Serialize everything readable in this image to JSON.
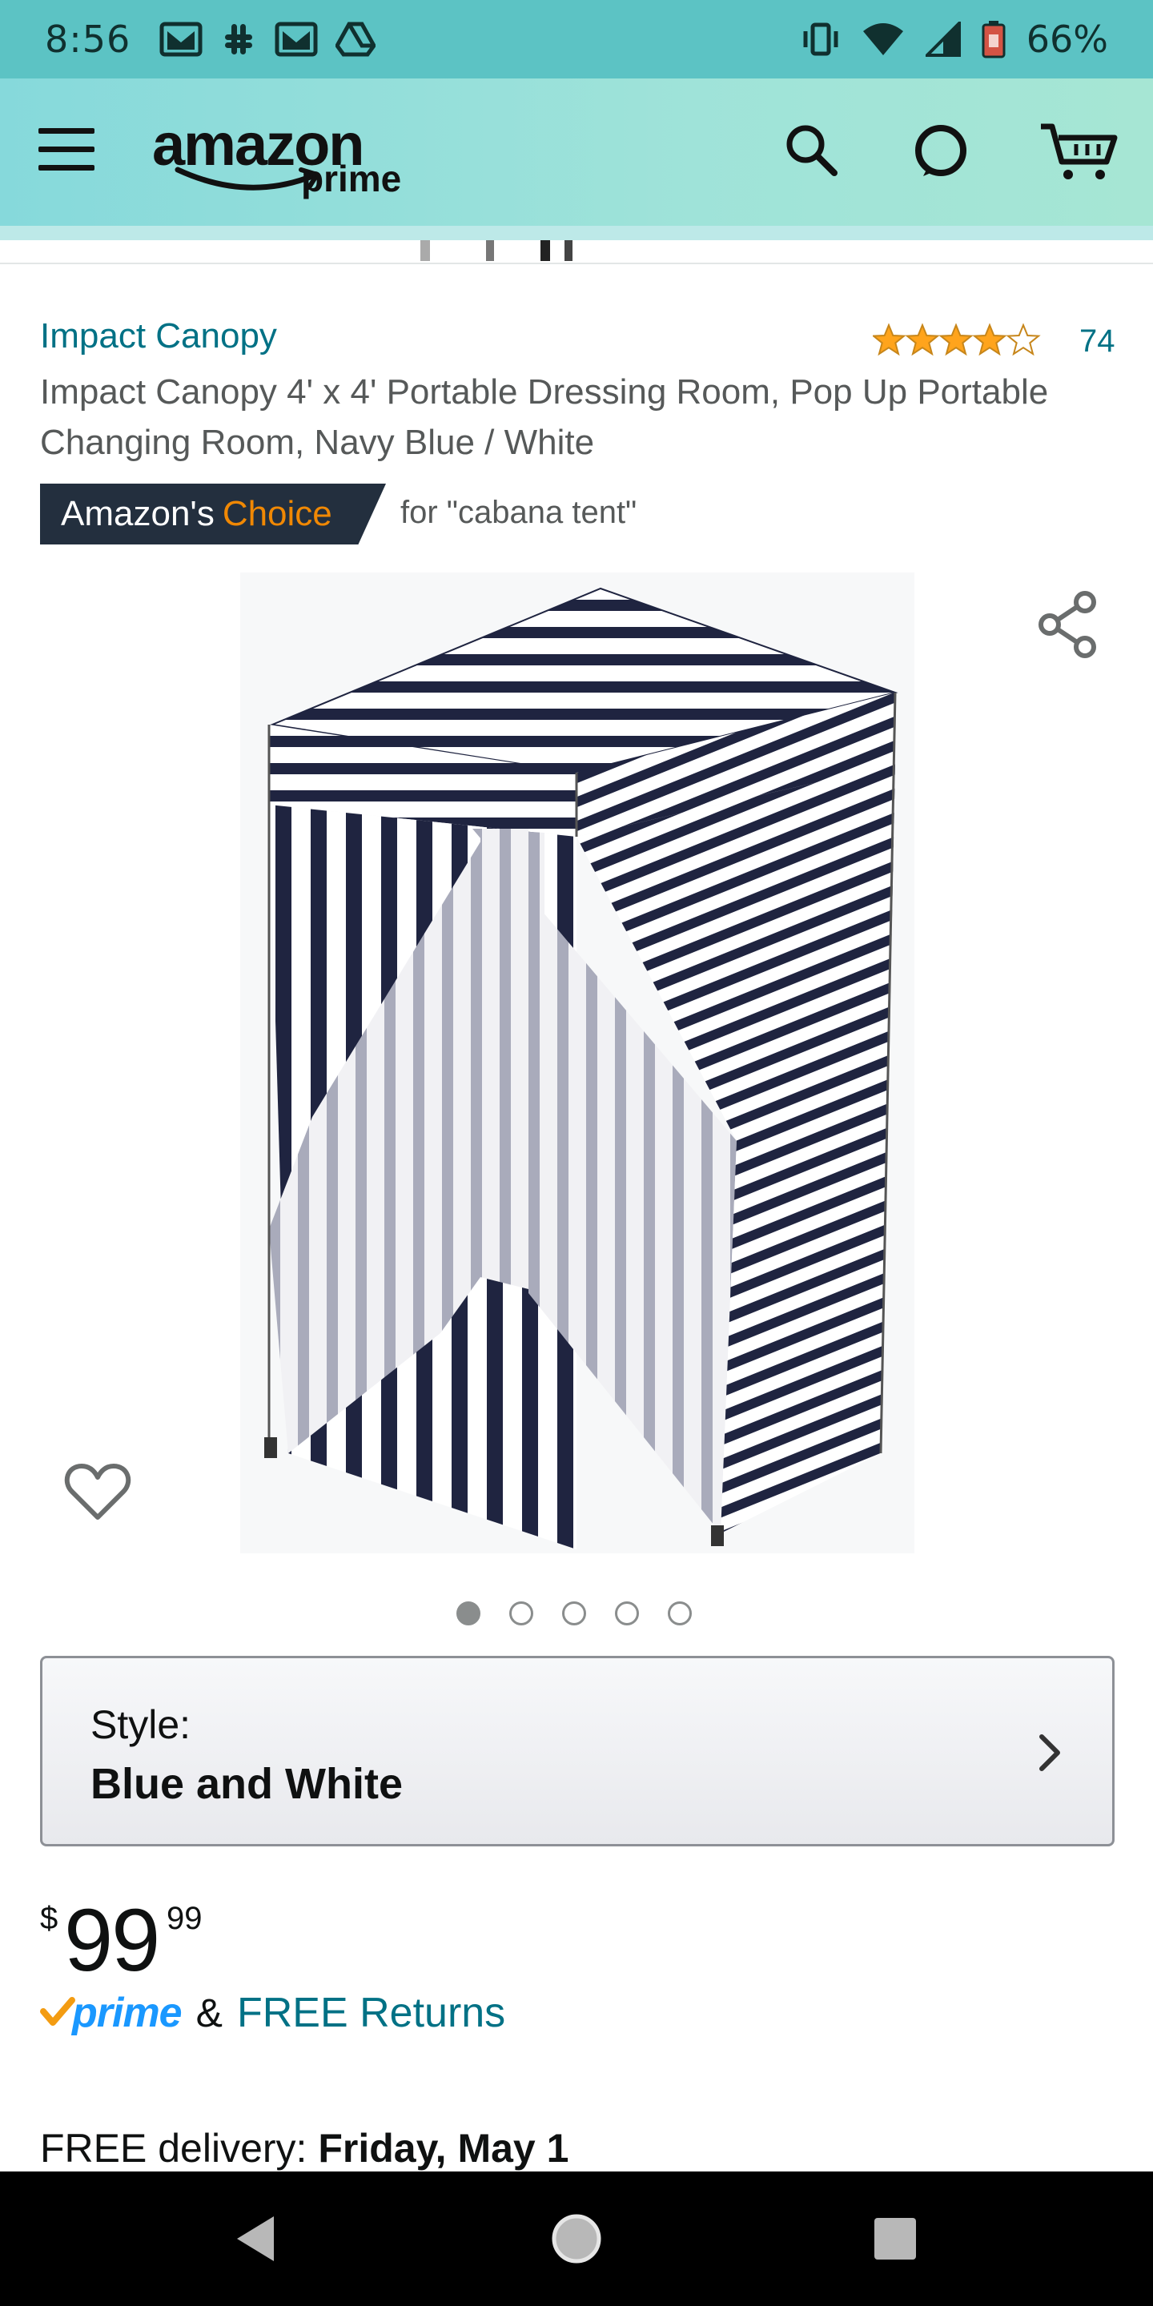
{
  "status_bar": {
    "time": "8:56",
    "left_icons": [
      "gmail-icon",
      "slack-icon",
      "gmail-icon",
      "drive-icon"
    ],
    "right_icons": [
      "vibrate-icon",
      "wifi-icon",
      "signal-icon",
      "battery-icon"
    ],
    "battery": "66%"
  },
  "header": {
    "logo_word": "amazon",
    "logo_sub": "prime",
    "icons": [
      "menu-icon",
      "search-icon",
      "alexa-icon",
      "cart-icon"
    ],
    "accent_color": "#86d9db"
  },
  "product": {
    "brand": "Impact Canopy",
    "rating_stars": 4.5,
    "rating_count": "74",
    "title": "Impact Canopy 4' x 4' Portable Dressing Room, Pop Up Portable Changing Room, Navy Blue / White",
    "badge_prefix": "Amazon's",
    "badge_highlight": "Choice",
    "badge_for": "for \"cabana tent\"",
    "image_count": 5,
    "active_image": 1
  },
  "style": {
    "label": "Style:",
    "value": "Blue and White"
  },
  "price": {
    "symbol": "$",
    "whole": "99",
    "fraction": "99"
  },
  "prime": {
    "word": "prime",
    "amp": "&",
    "returns": "FREE Returns"
  },
  "delivery": {
    "label": "FREE delivery:",
    "date": "Friday, May 1"
  },
  "nav": {
    "icons": [
      "back-icon",
      "home-icon",
      "recents-icon"
    ]
  },
  "colors": {
    "link": "#007185",
    "badge_bg": "#232f3e",
    "badge_orange": "#f08804",
    "star": "#ffa41c",
    "prime_blue": "#1a98ff"
  }
}
